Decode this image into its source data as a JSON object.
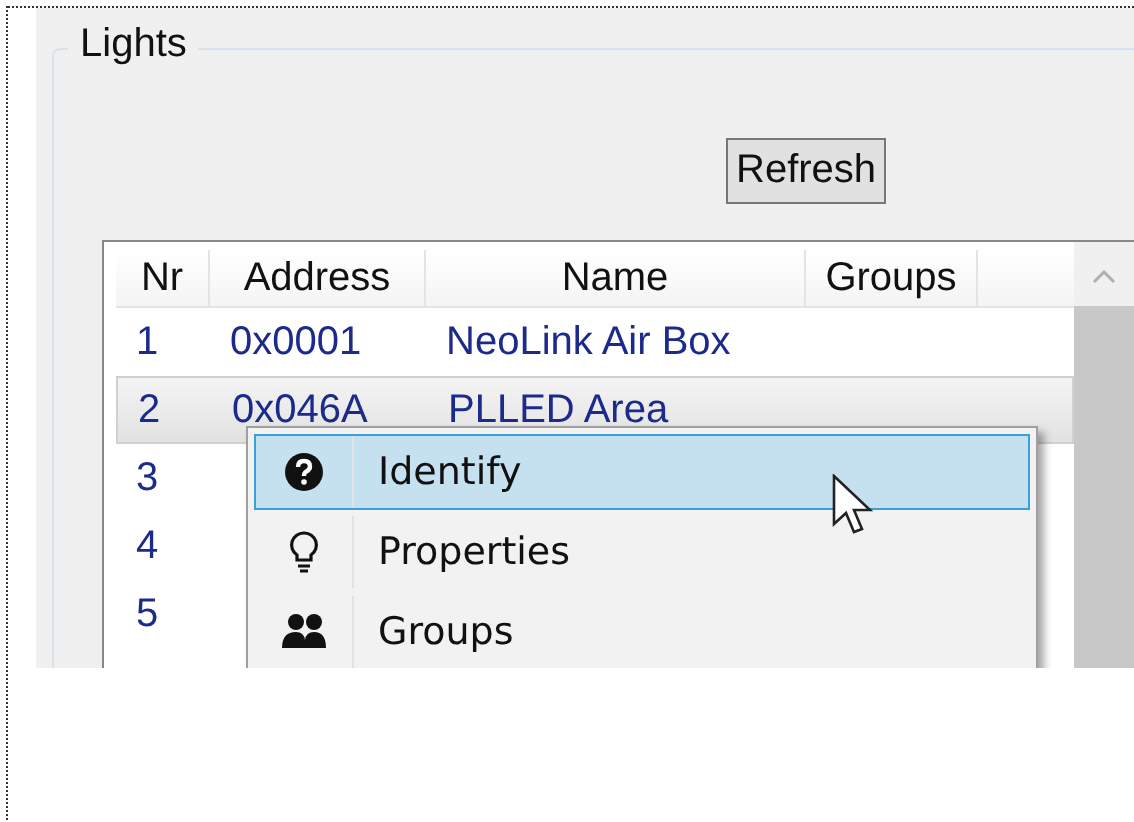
{
  "group": {
    "title": "Lights"
  },
  "refresh_button": {
    "label": "Refresh"
  },
  "table": {
    "columns": [
      "Nr",
      "Address",
      "Name",
      "Groups"
    ],
    "rows": [
      {
        "nr": "1",
        "address": "0x0001",
        "name": "NeoLink Air Box",
        "selected": false
      },
      {
        "nr": "2",
        "address": "0x046A",
        "name": "PLLED Area",
        "selected": true
      },
      {
        "nr": "3",
        "selected": false
      },
      {
        "nr": "4",
        "selected": false
      },
      {
        "nr": "5",
        "selected": false
      }
    ]
  },
  "context_menu": {
    "items": [
      {
        "kind": "help",
        "label": "Identify",
        "selected": true
      },
      {
        "kind": "bulb",
        "label": "Properties",
        "selected": false
      },
      {
        "kind": "people",
        "label": "Groups",
        "selected": false
      }
    ]
  }
}
